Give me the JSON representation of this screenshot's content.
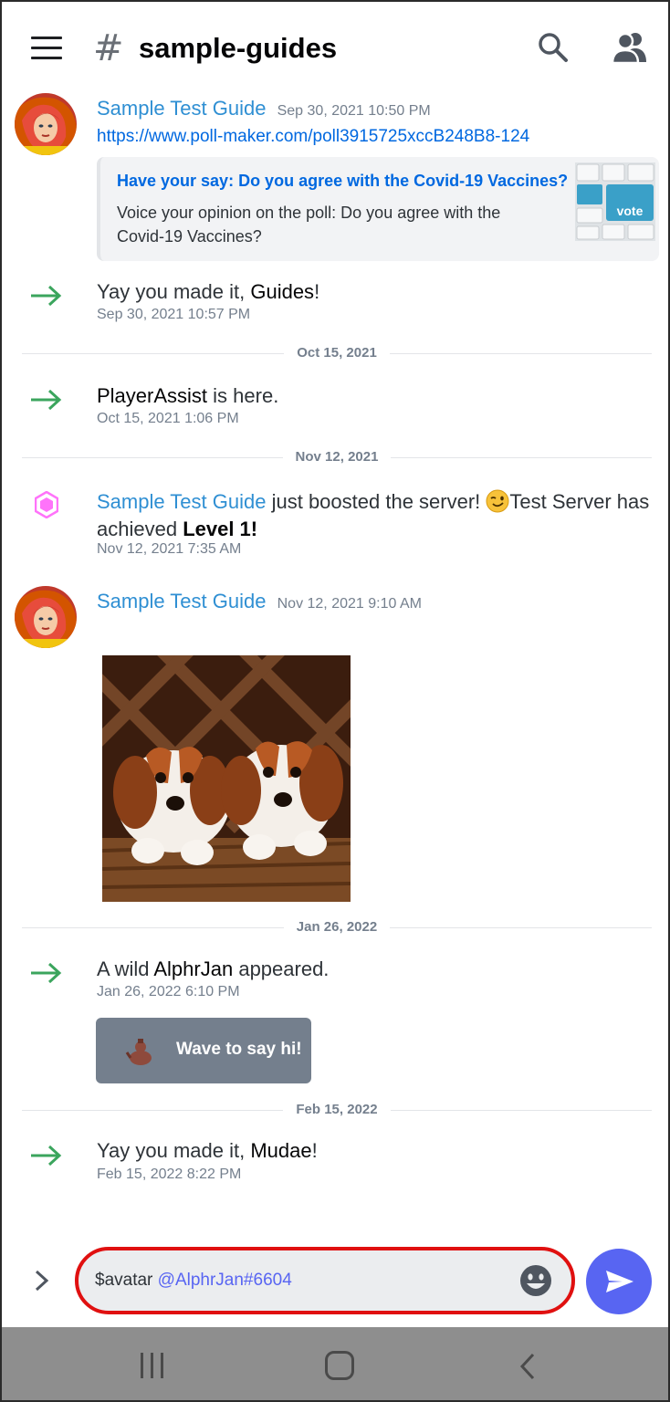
{
  "header": {
    "hash_symbol": "#",
    "channel_name": "sample-guides",
    "icons": [
      "hamburger-menu-icon",
      "search-icon",
      "members-icon"
    ]
  },
  "messages": {
    "m1": {
      "username": "Sample Test Guide",
      "timestamp": "Sep 30, 2021 10:50 PM",
      "link": "https://www.poll-maker.com/poll3915725xccB248B8-124",
      "embed": {
        "title": "Have your say: Do you agree with the Covid-19 Vaccines?",
        "description": "Voice your opinion on the poll:  Do you agree with the Covid-19 Vaccines?",
        "thumb_label": "vote"
      }
    },
    "s1": {
      "prefix": "Yay you made it, ",
      "name": "Guides",
      "suffix": "!",
      "timestamp": "Sep 30, 2021 10:57 PM"
    },
    "d1": "Oct 15, 2021",
    "s2": {
      "prefix": "",
      "name": "PlayerAssist",
      "suffix": " is here.",
      "timestamp": "Oct 15, 2021 1:06 PM"
    },
    "d2": "Nov 12, 2021",
    "boost": {
      "username": "Sample Test Guide",
      "text_a": " just boosted the server! ",
      "text_b": "Test Server has achieved ",
      "level": "Level 1!",
      "timestamp": "Nov 12, 2021 7:35 AM"
    },
    "m2": {
      "username": "Sample Test Guide",
      "timestamp": "Nov 12, 2021 9:10 AM"
    },
    "d3": "Jan 26, 2022",
    "s3": {
      "prefix": "A wild ",
      "name": "AlphrJan",
      "suffix": " appeared.",
      "timestamp": "Jan 26, 2022 6:10 PM"
    },
    "wave_button": "Wave to say hi!",
    "d4": "Feb 15, 2022",
    "s4": {
      "prefix": "Yay you made it, ",
      "name": "Mudae",
      "suffix": "!",
      "timestamp": "Feb 15, 2022 8:22 PM"
    }
  },
  "composer": {
    "command": "$avatar ",
    "mention": "@AlphrJan#6604"
  },
  "colors": {
    "username": "#2f8fd3",
    "link": "#0068e0",
    "join_arrow": "#3ba55d",
    "boost_pink": "#ff73fa",
    "send_button": "#5865f2",
    "composer_highlight": "#e01010"
  }
}
